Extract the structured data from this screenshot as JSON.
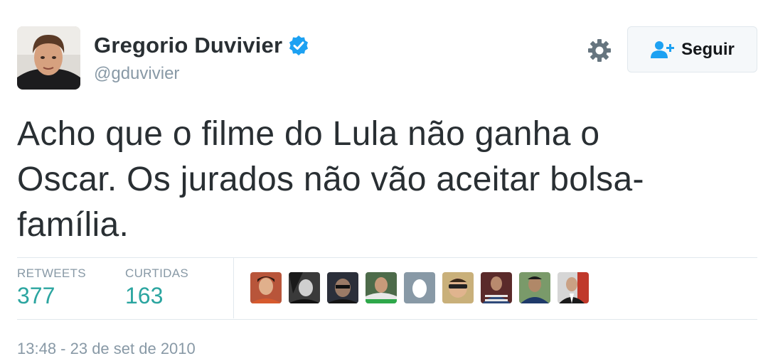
{
  "user": {
    "display_name": "Gregorio Duvivier",
    "handle": "@gduvivier",
    "verified": true,
    "avatar_icon": "profile-photo"
  },
  "actions": {
    "settings_icon": "gear-icon",
    "follow_icon": "add-user-icon",
    "follow_label": "Seguir"
  },
  "tweet": {
    "lines": [
      "Acho que o filme do Lula não ganha o",
      "Oscar. Os jurados não vão aceitar bolsa-",
      "família."
    ]
  },
  "stats": {
    "retweets_label": "RETWEETS",
    "retweets_value": "377",
    "likes_label": "CURTIDAS",
    "likes_value": "163"
  },
  "likers_count_shown": 9,
  "timestamp": "13:48 - 23 de set de 2010",
  "colors": {
    "verified": "#1da1f2",
    "stat_value": "#2ba5a0",
    "muted": "#8899a6",
    "text": "#292f33"
  }
}
